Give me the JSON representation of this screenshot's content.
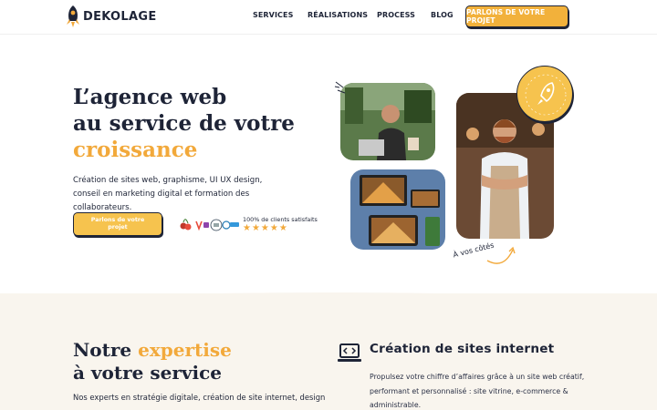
{
  "brand": {
    "name": "DEKOLAGE",
    "accent": "#f2a93b",
    "dark": "#1e2437",
    "cream": "#f9f5ee"
  },
  "nav": {
    "items": [
      "SERVICES",
      "RÉALISATIONS",
      "PROCESS",
      "BLOG"
    ],
    "cta": "PARLONS DE VOTRE PROJET"
  },
  "hero": {
    "title_line1": "L’agence web",
    "title_line2": "au service de votre",
    "title_accent": "croissance",
    "desc_line1": "Création de sites web, graphisme, UI UX design,",
    "desc_line2": "conseil en marketing digital et formation des collaborateurs.",
    "cta": "Parlons de votre projet",
    "satisfied": "100% de clients satisfaits",
    "stars": "★★★★★",
    "badge_icon": "rocket-icon",
    "side_note": "À vos côtés"
  },
  "expertise": {
    "title_prefix": "Notre ",
    "title_accent": "expertise",
    "title_line2": "à votre service",
    "desc": "Nos experts en stratégie digitale, création de site internet, design"
  },
  "service": {
    "icon": "code-laptop-icon",
    "title": "Création de sites internet",
    "desc": "Propulsez votre chiffre d’affaires grâce à un site web créatif, performant et personnalisé : site vitrine, e-commerce & administrable."
  }
}
